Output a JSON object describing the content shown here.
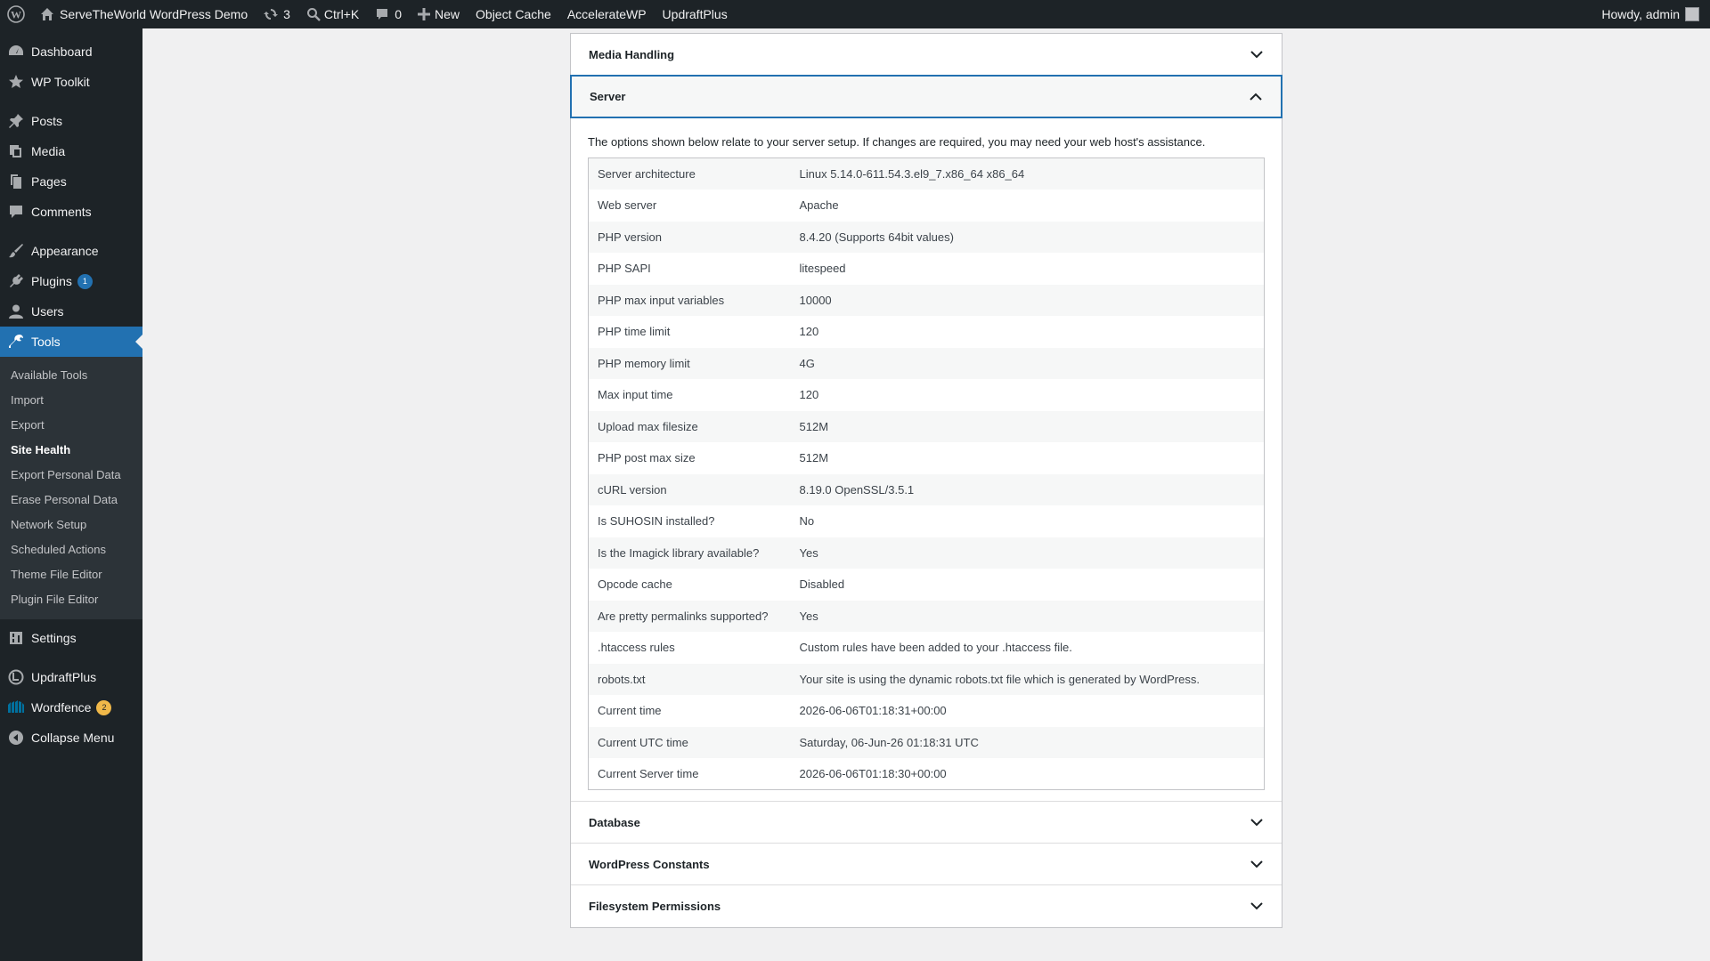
{
  "adminbar": {
    "site_name": "ServeTheWorld WordPress Demo",
    "updates_count": "3",
    "search_label": "Ctrl+K",
    "comments_count": "0",
    "new_label": "New",
    "object_cache": "Object Cache",
    "accelerate": "AccelerateWP",
    "updraft": "UpdraftPlus",
    "howdy": "Howdy, admin"
  },
  "sidebar": {
    "dashboard": "Dashboard",
    "wp_toolkit": "WP Toolkit",
    "posts": "Posts",
    "media": "Media",
    "pages": "Pages",
    "comments": "Comments",
    "appearance": "Appearance",
    "plugins": "Plugins",
    "plugins_badge": "1",
    "users": "Users",
    "tools": "Tools",
    "submenu": [
      {
        "label": "Available Tools"
      },
      {
        "label": "Import"
      },
      {
        "label": "Export"
      },
      {
        "label": "Site Health"
      },
      {
        "label": "Export Personal Data"
      },
      {
        "label": "Erase Personal Data"
      },
      {
        "label": "Network Setup"
      },
      {
        "label": "Scheduled Actions"
      },
      {
        "label": "Theme File Editor"
      },
      {
        "label": "Plugin File Editor"
      }
    ],
    "settings": "Settings",
    "updraftplus": "UpdraftPlus",
    "wordfence": "Wordfence",
    "wordfence_badge": "2",
    "collapse": "Collapse Menu"
  },
  "sections": {
    "media_handling": "Media Handling",
    "server": "Server",
    "database": "Database",
    "wp_constants": "WordPress Constants",
    "fs_permissions": "Filesystem Permissions"
  },
  "server": {
    "intro": "The options shown below relate to your server setup. If changes are required, you may need your web host's assistance.",
    "rows": [
      {
        "label": "Server architecture",
        "value": "Linux 5.14.0-611.54.3.el9_7.x86_64 x86_64"
      },
      {
        "label": "Web server",
        "value": "Apache"
      },
      {
        "label": "PHP version",
        "value": "8.4.20 (Supports 64bit values)"
      },
      {
        "label": "PHP SAPI",
        "value": "litespeed"
      },
      {
        "label": "PHP max input variables",
        "value": "10000"
      },
      {
        "label": "PHP time limit",
        "value": "120"
      },
      {
        "label": "PHP memory limit",
        "value": "4G"
      },
      {
        "label": "Max input time",
        "value": "120"
      },
      {
        "label": "Upload max filesize",
        "value": "512M"
      },
      {
        "label": "PHP post max size",
        "value": "512M"
      },
      {
        "label": "cURL version",
        "value": "8.19.0 OpenSSL/3.5.1"
      },
      {
        "label": "Is SUHOSIN installed?",
        "value": "No"
      },
      {
        "label": "Is the Imagick library available?",
        "value": "Yes"
      },
      {
        "label": "Opcode cache",
        "value": "Disabled"
      },
      {
        "label": "Are pretty permalinks supported?",
        "value": "Yes"
      },
      {
        "label": ".htaccess rules",
        "value": "Custom rules have been added to your .htaccess file."
      },
      {
        "label": "robots.txt",
        "value": "Your site is using the dynamic robots.txt file which is generated by WordPress."
      },
      {
        "label": "Current time",
        "value": "2026-06-06T01:18:31+00:00"
      },
      {
        "label": "Current UTC time",
        "value": "Saturday, 06-Jun-26 01:18:31 UTC"
      },
      {
        "label": "Current Server time",
        "value": "2026-06-06T01:18:30+00:00"
      }
    ]
  }
}
